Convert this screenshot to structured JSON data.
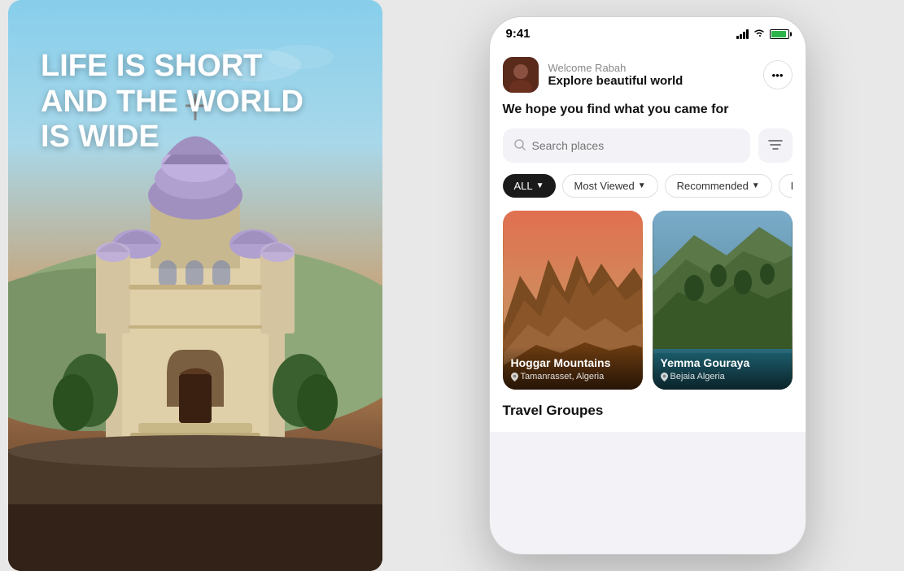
{
  "left_panel": {
    "headline_line1": "LIFE IS SHORT",
    "headline_line2": "AND THE WORLD",
    "headline_line3": "IS WIDE"
  },
  "status_bar": {
    "time": "9:41",
    "signal": "signal-icon",
    "wifi": "wifi-icon",
    "battery": "battery-icon"
  },
  "header": {
    "welcome": "Welcome Rabah",
    "subtitle": "Explore beautiful world",
    "more_button": "•••"
  },
  "tagline": "We hope you find what you came for",
  "search": {
    "placeholder": "Search places",
    "filter_icon": "filter-icon"
  },
  "chips": [
    {
      "label": "ALL",
      "active": true,
      "arrow": "▼"
    },
    {
      "label": "Most Viewed",
      "active": false,
      "arrow": "▼"
    },
    {
      "label": "Recommended",
      "active": false,
      "arrow": "▼"
    },
    {
      "label": "Re...",
      "active": false,
      "arrow": ""
    }
  ],
  "places": [
    {
      "name": "Hoggar Mountains",
      "location": "Tamanrasset, Algeria",
      "type": "desert-mountains"
    },
    {
      "name": "Yemma Gouraya",
      "location": "Bejaia Algeria",
      "type": "coastal-mountain"
    }
  ],
  "sections": [
    {
      "title": "Travel Groupes"
    }
  ],
  "icons": {
    "search": "🔍",
    "pin": "📍",
    "filter": "⚙"
  }
}
